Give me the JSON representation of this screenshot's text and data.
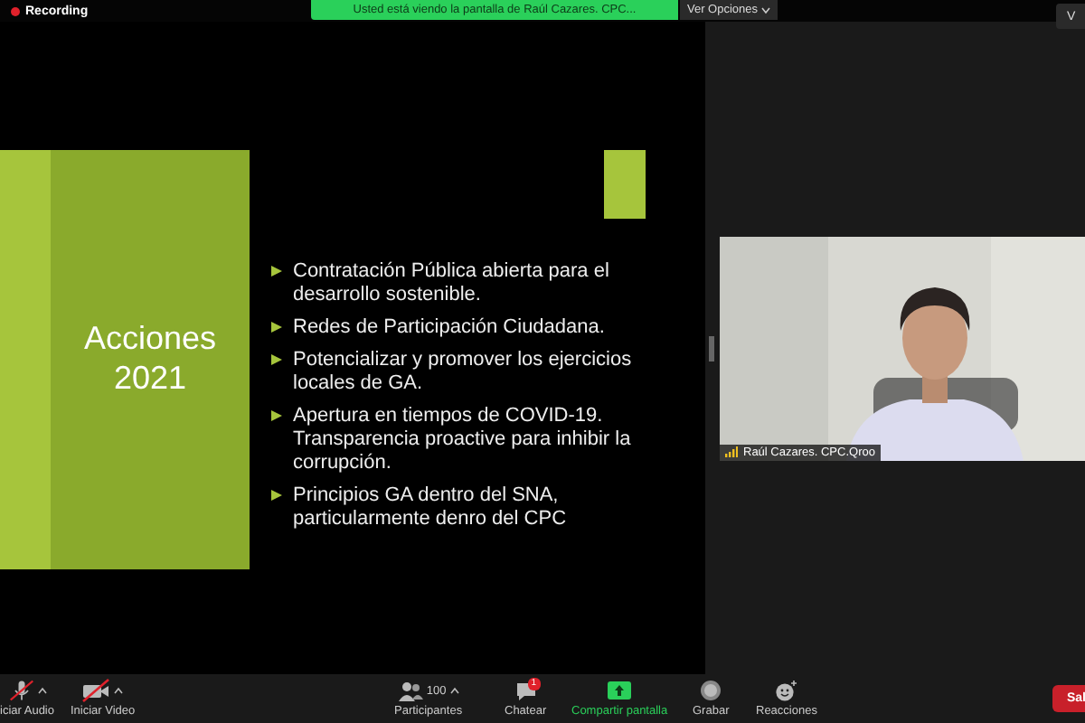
{
  "top_bar": {
    "recording": "Recording",
    "banner": "Usted está viendo la pantalla de Raúl Cazares. CPC...",
    "view_options": "Ver Opciones",
    "right_button": "V"
  },
  "slide": {
    "title_lines": [
      "Acciones",
      "2021"
    ],
    "bullets": [
      {
        "lines": [
          "Contratación Pública abierta para el",
          "desarrollo sostenible."
        ]
      },
      {
        "lines": [
          "Redes de Participación Ciudadana."
        ]
      },
      {
        "lines": [
          "Potencializar y promover los ejercicios",
          "locales de GA."
        ]
      },
      {
        "lines": [
          "Apertura en tiempos de COVID-19.",
          "Transparencia proactive para inhibir la",
          "corrupción."
        ]
      },
      {
        "lines": [
          "Principios GA dentro del SNA,",
          "particularmente denro del CPC"
        ]
      }
    ]
  },
  "video": {
    "name": "Raúl Cazares. CPC.Qroo"
  },
  "toolbar": {
    "items": [
      {
        "kind": "audio",
        "label": "iciar Audio",
        "muted": true
      },
      {
        "kind": "video",
        "label": "Iniciar Video",
        "muted": true
      },
      {
        "kind": "participants",
        "label": "Participantes",
        "count": "100"
      },
      {
        "kind": "chat",
        "label": "Chatear",
        "badge": "1"
      },
      {
        "kind": "share",
        "label": "Compartir pantalla"
      },
      {
        "kind": "record",
        "label": "Grabar"
      },
      {
        "kind": "reactions",
        "label": "Reacciones"
      }
    ],
    "leave": "Sal"
  }
}
